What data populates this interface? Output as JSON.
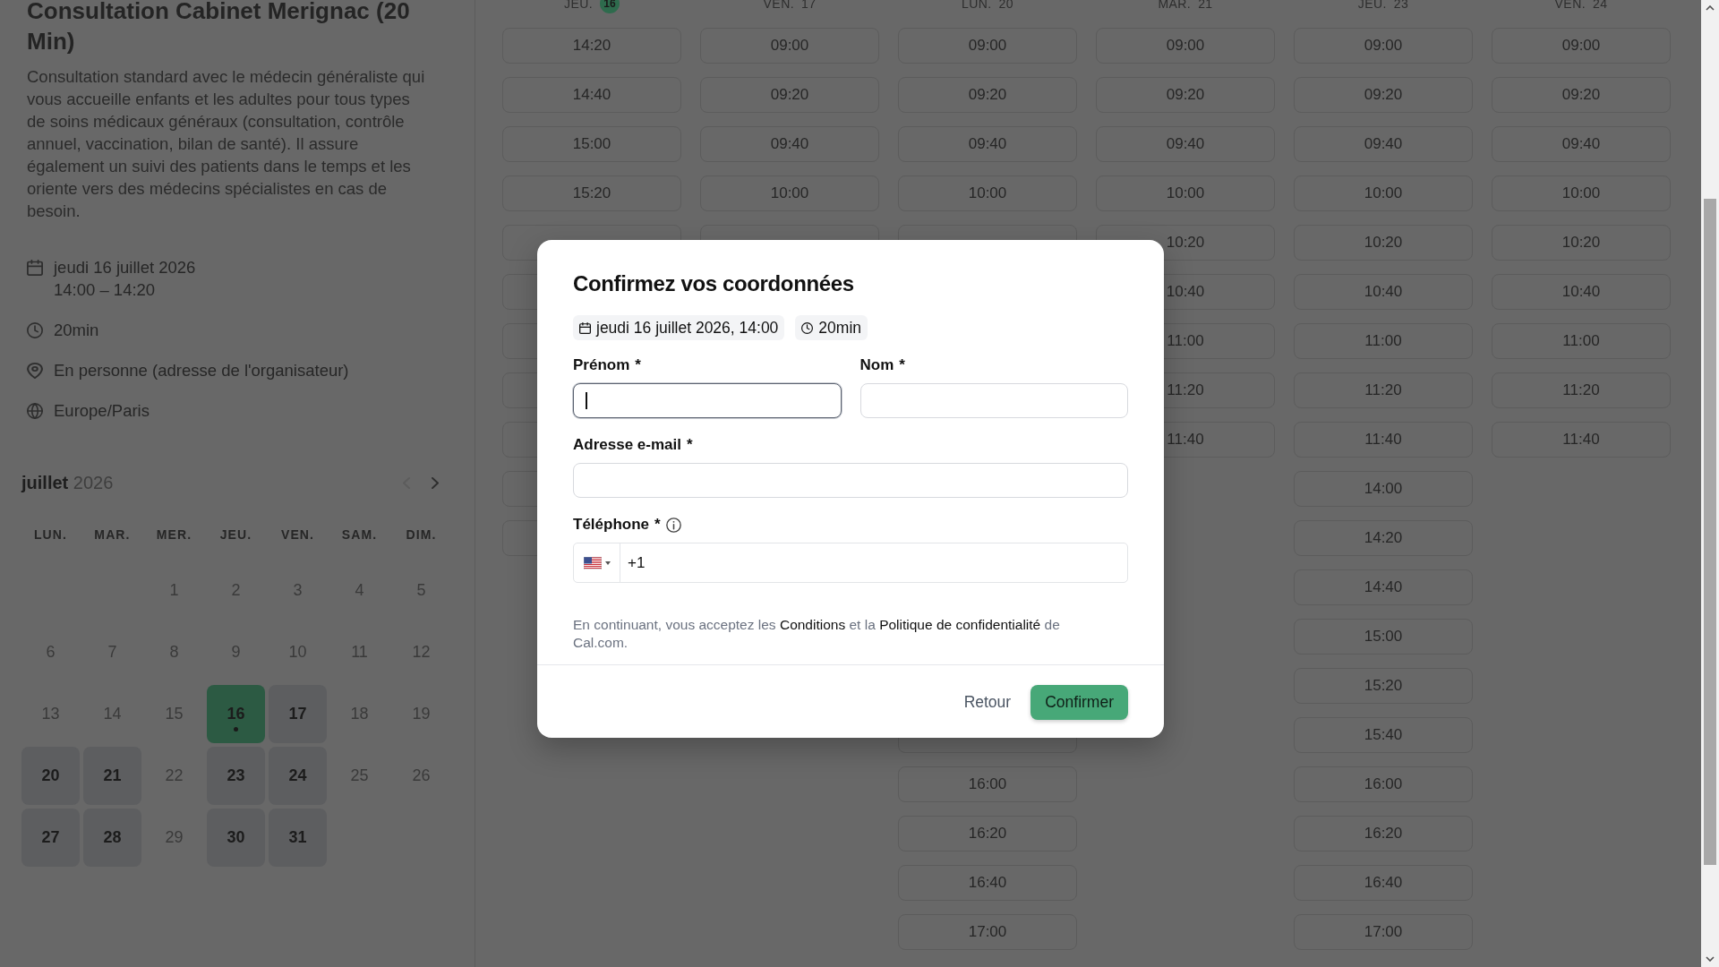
{
  "event": {
    "title": "Consultation Cabinet Merignac (20 Min)",
    "description": "Consultation standard avec le médecin généraliste qui vous accueille enfants et les adultes pour tous types de soins médicaux généraux (consultation, contrôle annuel, vaccination, bilan de santé). Il assure également un suivi des patients dans le temps et les oriente vers des médecins spécialistes en cas de besoin.",
    "details": [
      {
        "kind": "date",
        "lines": [
          "jeudi 16 juillet 2026",
          "14:00 – 14:20"
        ]
      },
      {
        "kind": "duration",
        "lines": [
          "20min"
        ]
      },
      {
        "kind": "location",
        "lines": [
          "En personne (adresse de l'organisateur)"
        ]
      },
      {
        "kind": "timezone",
        "lines": [
          "Europe/Paris"
        ]
      }
    ]
  },
  "calendar": {
    "month": "juillet",
    "year": "2026",
    "prev_disabled": true,
    "next_disabled": false,
    "weekdays": [
      "LUN.",
      "MAR.",
      "MER.",
      "JEU.",
      "VEN.",
      "SAM.",
      "DIM."
    ],
    "days": [
      {
        "kind": "blank"
      },
      {
        "kind": "blank"
      },
      {
        "kind": "day",
        "label": "1",
        "available": false,
        "selected": false,
        "dot": false
      },
      {
        "kind": "day",
        "label": "2",
        "available": false,
        "selected": false,
        "dot": false
      },
      {
        "kind": "day",
        "label": "3",
        "available": false,
        "selected": false,
        "dot": false
      },
      {
        "kind": "day",
        "label": "4",
        "available": false,
        "selected": false,
        "dot": false
      },
      {
        "kind": "day",
        "label": "5",
        "available": false,
        "selected": false,
        "dot": false
      },
      {
        "kind": "day",
        "label": "6",
        "available": false,
        "selected": false,
        "dot": false
      },
      {
        "kind": "day",
        "label": "7",
        "available": false,
        "selected": false,
        "dot": false
      },
      {
        "kind": "day",
        "label": "8",
        "available": false,
        "selected": false,
        "dot": false
      },
      {
        "kind": "day",
        "label": "9",
        "available": false,
        "selected": false,
        "dot": false
      },
      {
        "kind": "day",
        "label": "10",
        "available": false,
        "selected": false,
        "dot": false
      },
      {
        "kind": "day",
        "label": "11",
        "available": false,
        "selected": false,
        "dot": false
      },
      {
        "kind": "day",
        "label": "12",
        "available": false,
        "selected": false,
        "dot": false
      },
      {
        "kind": "day",
        "label": "13",
        "available": false,
        "selected": false,
        "dot": false
      },
      {
        "kind": "day",
        "label": "14",
        "available": false,
        "selected": false,
        "dot": false
      },
      {
        "kind": "day",
        "label": "15",
        "available": false,
        "selected": false,
        "dot": false
      },
      {
        "kind": "day",
        "label": "16",
        "available": true,
        "selected": true,
        "dot": true
      },
      {
        "kind": "day",
        "label": "17",
        "available": true,
        "selected": false,
        "dot": false
      },
      {
        "kind": "day",
        "label": "18",
        "available": false,
        "selected": false,
        "dot": false
      },
      {
        "kind": "day",
        "label": "19",
        "available": false,
        "selected": false,
        "dot": false
      },
      {
        "kind": "day",
        "label": "20",
        "available": true,
        "selected": false,
        "dot": false
      },
      {
        "kind": "day",
        "label": "21",
        "available": true,
        "selected": false,
        "dot": false
      },
      {
        "kind": "day",
        "label": "22",
        "available": false,
        "selected": false,
        "dot": false
      },
      {
        "kind": "day",
        "label": "23",
        "available": true,
        "selected": false,
        "dot": false
      },
      {
        "kind": "day",
        "label": "24",
        "available": true,
        "selected": false,
        "dot": false
      },
      {
        "kind": "day",
        "label": "25",
        "available": false,
        "selected": false,
        "dot": false
      },
      {
        "kind": "day",
        "label": "26",
        "available": false,
        "selected": false,
        "dot": false
      },
      {
        "kind": "day",
        "label": "27",
        "available": true,
        "selected": false,
        "dot": false
      },
      {
        "kind": "day",
        "label": "28",
        "available": true,
        "selected": false,
        "dot": false
      },
      {
        "kind": "day",
        "label": "29",
        "available": false,
        "selected": false,
        "dot": false
      },
      {
        "kind": "day",
        "label": "30",
        "available": true,
        "selected": false,
        "dot": false
      },
      {
        "kind": "day",
        "label": "31",
        "available": true,
        "selected": false,
        "dot": false
      }
    ]
  },
  "schedule": {
    "columns": [
      {
        "day": "JEU.",
        "date": "16",
        "selected": true,
        "slots": [
          {
            "kind": "slot",
            "time": "14:20"
          },
          {
            "kind": "slot",
            "time": "14:40"
          },
          {
            "kind": "slot",
            "time": "15:00"
          },
          {
            "kind": "slot",
            "time": "15:20"
          },
          {
            "kind": "stub"
          },
          {
            "kind": "stub"
          },
          {
            "kind": "stub"
          },
          {
            "kind": "stub"
          },
          {
            "kind": "stub"
          },
          {
            "kind": "stub"
          },
          {
            "kind": "stub"
          }
        ]
      },
      {
        "day": "VEN.",
        "date": "17",
        "selected": false,
        "slots": [
          {
            "kind": "slot",
            "time": "09:00"
          },
          {
            "kind": "slot",
            "time": "09:20"
          },
          {
            "kind": "slot",
            "time": "09:40"
          },
          {
            "kind": "slot",
            "time": "10:00"
          },
          {
            "kind": "stub"
          }
        ]
      },
      {
        "day": "LUN.",
        "date": "20",
        "selected": false,
        "slots": [
          {
            "kind": "slot",
            "time": "09:00"
          },
          {
            "kind": "slot",
            "time": "09:20"
          },
          {
            "kind": "slot",
            "time": "09:40"
          },
          {
            "kind": "slot",
            "time": "10:00"
          },
          {
            "kind": "stub"
          },
          {
            "kind": "covered"
          },
          {
            "kind": "covered"
          },
          {
            "kind": "covered"
          },
          {
            "kind": "covered"
          },
          {
            "kind": "covered"
          },
          {
            "kind": "covered"
          },
          {
            "kind": "covered"
          },
          {
            "kind": "covered"
          },
          {
            "kind": "covered"
          },
          {
            "kind": "stub"
          },
          {
            "kind": "slot",
            "time": "16:00"
          },
          {
            "kind": "slot",
            "time": "16:20"
          },
          {
            "kind": "slot",
            "time": "16:40"
          },
          {
            "kind": "slot",
            "time": "17:00"
          }
        ]
      },
      {
        "day": "MAR.",
        "date": "21",
        "selected": false,
        "slots": [
          {
            "kind": "slot",
            "time": "09:00"
          },
          {
            "kind": "slot",
            "time": "09:20"
          },
          {
            "kind": "slot",
            "time": "09:40"
          },
          {
            "kind": "slot",
            "time": "10:00"
          },
          {
            "kind": "slot",
            "time": "10:20"
          },
          {
            "kind": "slot",
            "time": "10:40"
          },
          {
            "kind": "slot",
            "time": "11:00"
          },
          {
            "kind": "slot",
            "time": "11:20"
          },
          {
            "kind": "slot",
            "time": "11:40"
          }
        ]
      },
      {
        "day": "JEU.",
        "date": "23",
        "selected": false,
        "slots": [
          {
            "kind": "slot",
            "time": "09:00"
          },
          {
            "kind": "slot",
            "time": "09:20"
          },
          {
            "kind": "slot",
            "time": "09:40"
          },
          {
            "kind": "slot",
            "time": "10:00"
          },
          {
            "kind": "slot",
            "time": "10:20"
          },
          {
            "kind": "slot",
            "time": "10:40"
          },
          {
            "kind": "slot",
            "time": "11:00"
          },
          {
            "kind": "slot",
            "time": "11:20"
          },
          {
            "kind": "slot",
            "time": "11:40"
          },
          {
            "kind": "slot",
            "time": "14:00"
          },
          {
            "kind": "slot",
            "time": "14:20"
          },
          {
            "kind": "slot",
            "time": "14:40"
          },
          {
            "kind": "slot",
            "time": "15:00"
          },
          {
            "kind": "slot",
            "time": "15:20"
          },
          {
            "kind": "slot",
            "time": "15:40"
          },
          {
            "kind": "slot",
            "time": "16:00"
          },
          {
            "kind": "slot",
            "time": "16:20"
          },
          {
            "kind": "slot",
            "time": "16:40"
          },
          {
            "kind": "slot",
            "time": "17:00"
          }
        ]
      },
      {
        "day": "VEN.",
        "date": "24",
        "selected": false,
        "slots": [
          {
            "kind": "slot",
            "time": "09:00"
          },
          {
            "kind": "slot",
            "time": "09:20"
          },
          {
            "kind": "slot",
            "time": "09:40"
          },
          {
            "kind": "slot",
            "time": "10:00"
          },
          {
            "kind": "slot",
            "time": "10:20"
          },
          {
            "kind": "slot",
            "time": "10:40"
          },
          {
            "kind": "slot",
            "time": "11:00"
          },
          {
            "kind": "slot",
            "time": "11:20"
          },
          {
            "kind": "slot",
            "time": "11:40"
          }
        ]
      }
    ]
  },
  "dialog": {
    "title": "Confirmez vos coordonnées",
    "chips": [
      {
        "kind": "date",
        "text": "jeudi 16 juillet 2026, 14:00"
      },
      {
        "kind": "duration",
        "text": "20min"
      }
    ],
    "field_rows": [
      {
        "fields": [
          {
            "kind": "text",
            "label": "Prénom",
            "required_mark": "*",
            "focused": true
          },
          {
            "kind": "text",
            "label": "Nom",
            "required_mark": "*",
            "focused": false
          }
        ]
      },
      {
        "fields": [
          {
            "kind": "text",
            "label": "Adresse e-mail",
            "required_mark": "*",
            "focused": false
          }
        ]
      },
      {
        "fields": [
          {
            "kind": "phone",
            "label": "Téléphone",
            "required_mark": "*",
            "info": true,
            "value": "+1",
            "focused": false
          }
        ]
      }
    ],
    "terms": [
      {
        "kind": "text",
        "text": "En continuant, vous acceptez les"
      },
      {
        "kind": "link",
        "text": "Conditions"
      },
      {
        "kind": "text",
        "text": "et la"
      },
      {
        "kind": "link",
        "text": "Politique de confidentialité"
      },
      {
        "kind": "text",
        "text": "de Cal.com."
      }
    ],
    "buttons": [
      {
        "kind": "secondary",
        "label": "Retour"
      },
      {
        "kind": "primary",
        "label": "Confirmer"
      }
    ]
  }
}
